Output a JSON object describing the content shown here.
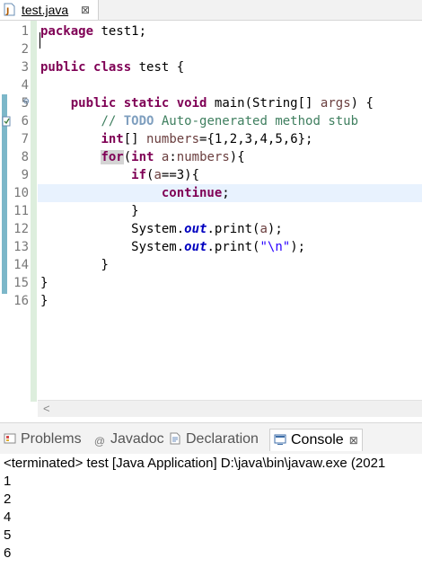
{
  "editor": {
    "tab": {
      "label": "test.java",
      "close": "⊠"
    },
    "lines": [
      "1",
      "2",
      "3",
      "4",
      "5",
      "6",
      "7",
      "8",
      "9",
      "10",
      "11",
      "12",
      "13",
      "14",
      "15",
      "16"
    ]
  },
  "code": {
    "l1": {
      "kw": "package",
      "rest": " test1;"
    },
    "l3": {
      "kw1": "public",
      "kw2": "class",
      "rest": " test {"
    },
    "l5": {
      "kw1": "public",
      "kw2": "static",
      "kw3": "void",
      "mid": " main(String[] ",
      "param": "args",
      "end": ") {"
    },
    "l6": {
      "prefix": "// ",
      "todo": "TODO",
      "rest": " Auto-generated method stub"
    },
    "l7": {
      "kw": "int",
      "mid": "[] ",
      "var": "numbers",
      "rest": "={1,2,3,4,5,6};"
    },
    "l8": {
      "kw1": "for",
      "p1": "(",
      "kw2": "int",
      "sp": " ",
      "var1": "a",
      "colon": ":",
      "var2": "numbers",
      "end": "){"
    },
    "l9": {
      "kw": "if",
      "p1": "(",
      "var": "a",
      "rest": "==3){"
    },
    "l10": {
      "kw": "continue",
      "end": ";"
    },
    "l11": "}",
    "l12": {
      "pre": "System.",
      "field": "out",
      "mid": ".print(",
      "var": "a",
      "end": ");"
    },
    "l13": {
      "pre": "System.",
      "field": "out",
      "mid": ".print(",
      "str": "\"\\n\"",
      "end": ");"
    },
    "l14": "}",
    "l15": "}",
    "l16": "}"
  },
  "scroll": {
    "left_arrow": "<"
  },
  "console": {
    "tabs": [
      {
        "label": "Problems",
        "icon": "problems-icon"
      },
      {
        "label": "Javadoc",
        "icon": "at-icon"
      },
      {
        "label": "Declaration",
        "icon": "declaration-icon"
      },
      {
        "label": "Console",
        "icon": "console-icon",
        "close": "⊠"
      }
    ],
    "status": "<terminated> test [Java Application] D:\\java\\bin\\javaw.exe (2021",
    "output": [
      "1",
      "2",
      "4",
      "5",
      "6"
    ]
  },
  "colors": {
    "keyword": "#7f0055",
    "comment": "#3f7f5f",
    "string": "#2a00ff",
    "field": "#0000c0",
    "current_line": "#e8f2fe"
  }
}
